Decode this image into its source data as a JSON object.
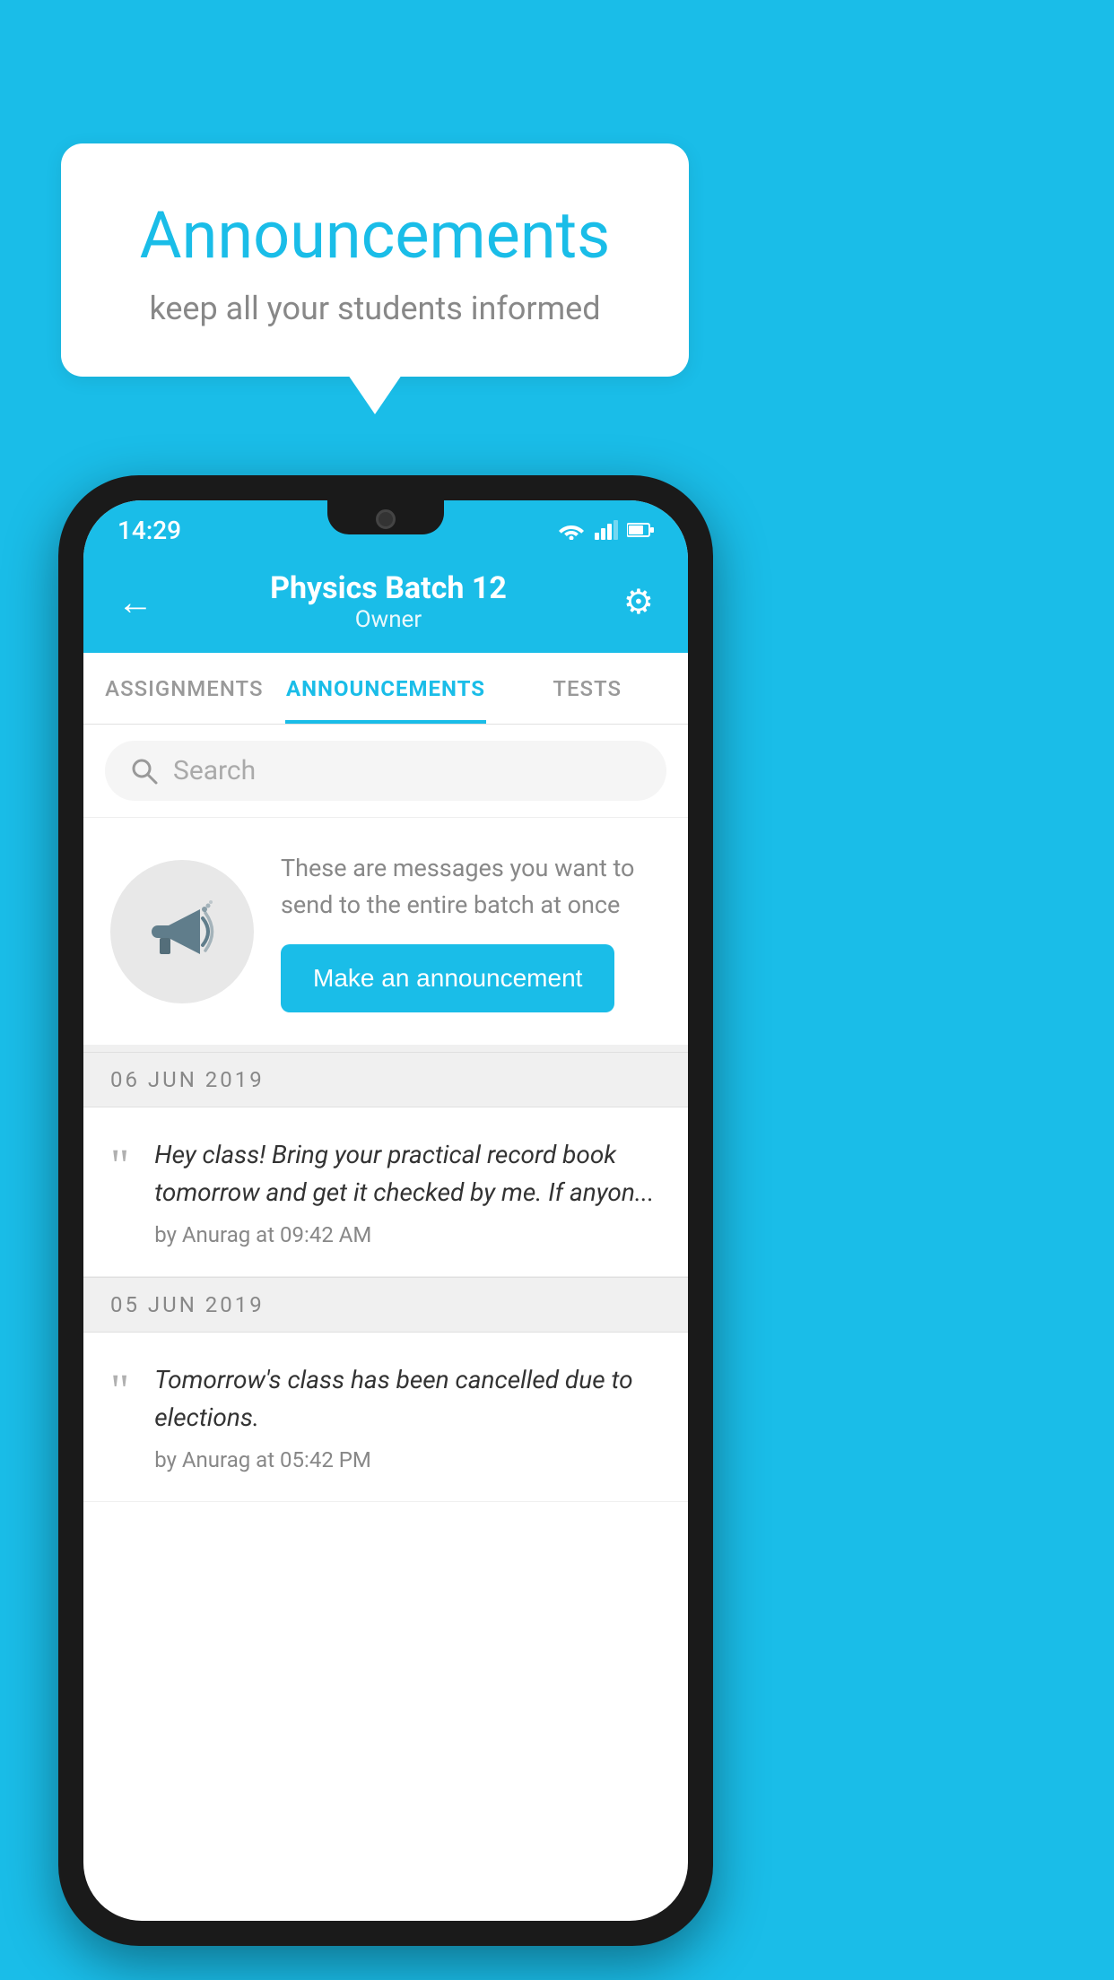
{
  "background_color": "#1ABDE8",
  "speech_bubble": {
    "title": "Announcements",
    "subtitle": "keep all your students informed"
  },
  "phone": {
    "status_bar": {
      "time": "14:29"
    },
    "header": {
      "title": "Physics Batch 12",
      "subtitle": "Owner",
      "back_label": "←",
      "gear_label": "⚙"
    },
    "tabs": [
      {
        "label": "ASSIGNMENTS",
        "active": false
      },
      {
        "label": "ANNOUNCEMENTS",
        "active": true
      },
      {
        "label": "TESTS",
        "active": false
      }
    ],
    "search": {
      "placeholder": "Search"
    },
    "promo": {
      "description": "These are messages you want to send to the entire batch at once",
      "button_label": "Make an announcement"
    },
    "announcements": [
      {
        "date": "06  JUN  2019",
        "text": "Hey class! Bring your practical record book tomorrow and get it checked by me. If anyon...",
        "meta": "by Anurag at 09:42 AM"
      },
      {
        "date": "05  JUN  2019",
        "text": "Tomorrow's class has been cancelled due to elections.",
        "meta": "by Anurag at 05:42 PM"
      }
    ]
  }
}
